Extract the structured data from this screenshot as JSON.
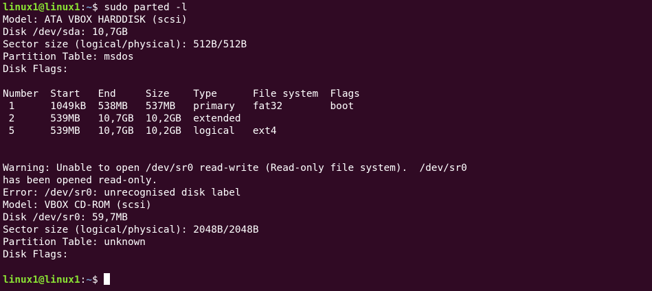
{
  "colors": {
    "background": "#300a24",
    "text": "#ffffff",
    "prompt_user": "#8ae234",
    "prompt_path": "#729fcf"
  },
  "prompt": {
    "user_host": "linux1@linux1",
    "separator": ":",
    "path": "~",
    "symbol": "$ "
  },
  "command": "sudo parted -l",
  "output_lines": [
    "Model: ATA VBOX HARDDISK (scsi)",
    "Disk /dev/sda: 10,7GB",
    "Sector size (logical/physical): 512B/512B",
    "Partition Table: msdos",
    "Disk Flags:",
    "",
    "Number  Start   End     Size    Type      File system  Flags",
    " 1      1049kB  538MB   537MB   primary   fat32        boot",
    " 2      539MB   10,7GB  10,2GB  extended",
    " 5      539MB   10,7GB  10,2GB  logical   ext4",
    "",
    "",
    "Warning: Unable to open /dev/sr0 read-write (Read-only file system).  /dev/sr0",
    "has been opened read-only.",
    "Error: /dev/sr0: unrecognised disk label",
    "Model: VBOX CD-ROM (scsi)",
    "Disk /dev/sr0: 59,7MB",
    "Sector size (logical/physical): 2048B/2048B",
    "Partition Table: unknown",
    "Disk Flags:",
    ""
  ]
}
